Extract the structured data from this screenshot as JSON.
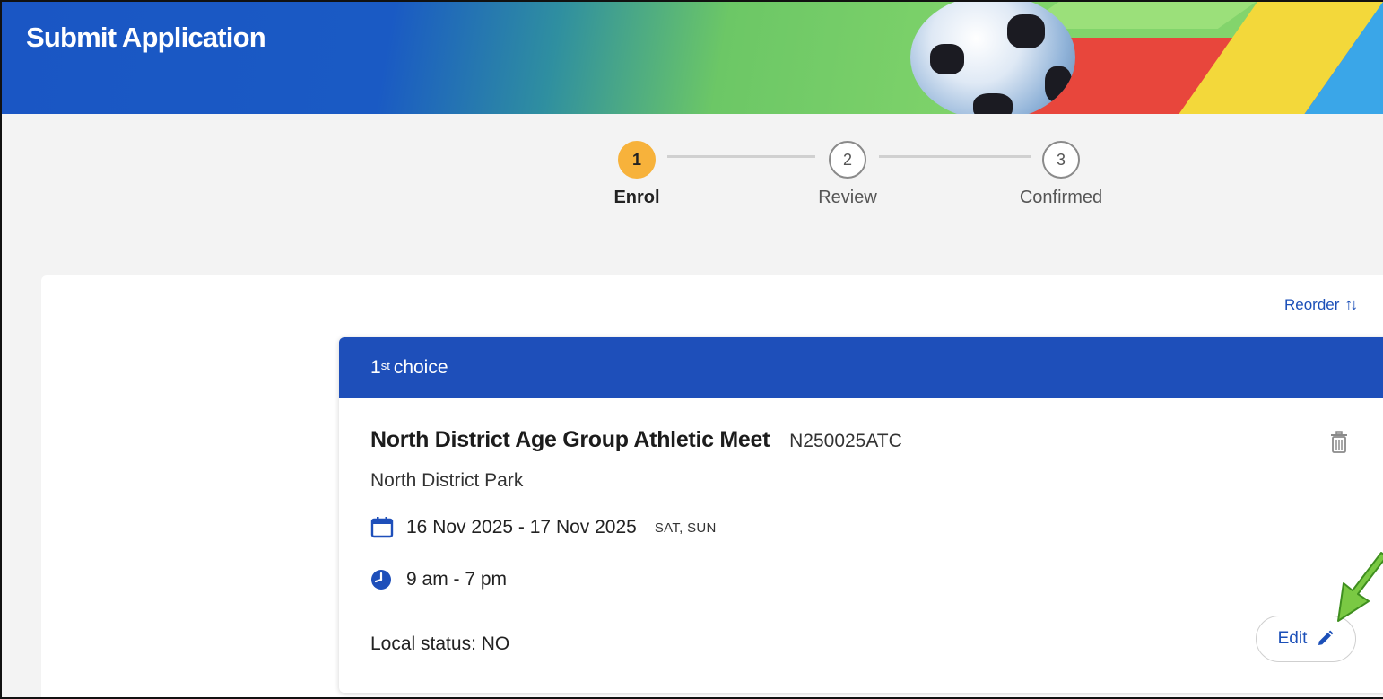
{
  "header": {
    "title": "Submit Application"
  },
  "stepper": {
    "steps": [
      {
        "number": "1",
        "label": "Enrol",
        "active": true
      },
      {
        "number": "2",
        "label": "Review",
        "active": false
      },
      {
        "number": "3",
        "label": "Confirmed",
        "active": false
      }
    ]
  },
  "reorder": {
    "label": "Reorder",
    "icon": "sort-arrows-icon"
  },
  "choice": {
    "ordinal": "1",
    "ordinal_suffix": "st",
    "label": "choice",
    "event_name": "North District Age Group Athletic Meet",
    "event_code": "N250025ATC",
    "venue": "North District Park",
    "date_range": "16 Nov 2025 - 17 Nov 2025",
    "days": "SAT, SUN",
    "time": "9 am - 7 pm",
    "local_status": "Local status: NO",
    "edit_label": "Edit"
  },
  "colors": {
    "primary": "#1e4fba",
    "active_step": "#f7b23b",
    "link": "#1b4fb8",
    "annotation_arrow": "#7ac943"
  }
}
